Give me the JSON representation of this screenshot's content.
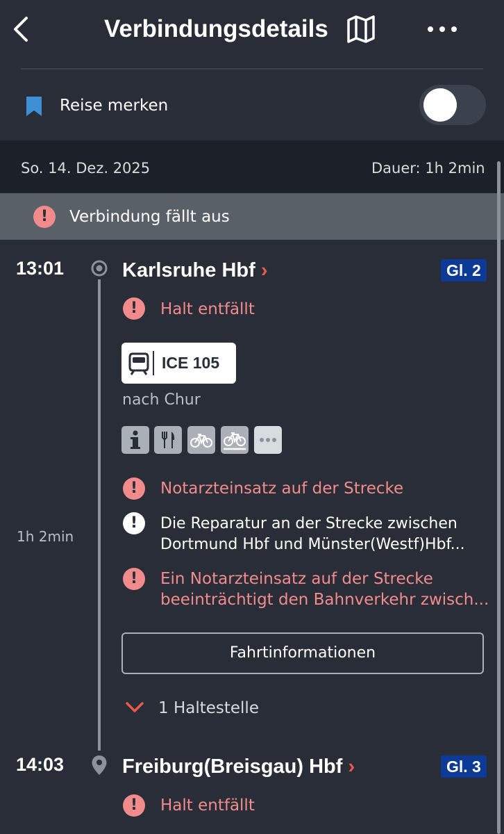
{
  "header": {
    "title": "Verbindungsdetails",
    "back_icon": "chevron-left-icon",
    "map_icon": "map-icon",
    "more_icon": "more-horizontal-icon"
  },
  "save_trip": {
    "label": "Reise merken",
    "icon": "bookmark-icon",
    "enabled": false
  },
  "info_bar": {
    "date": "So. 14. Dez. 2025",
    "duration": "Dauer: 1h 2min"
  },
  "banner": {
    "text": "Verbindung fällt aus"
  },
  "departure": {
    "time": "13:01",
    "station": "Karlsruhe Hbf",
    "chevron": "›",
    "platform": "Gl. 2",
    "stop_status": "Halt entfällt"
  },
  "train": {
    "name": "ICE 105",
    "direction": "nach Chur",
    "amenities": [
      "info-icon",
      "restaurant-icon",
      "bike-icon",
      "bike-reservation-icon",
      "more-icon"
    ]
  },
  "travel_time": "1h 2min",
  "messages": [
    {
      "severity": "error",
      "text": "Notarzteinsatz auf der Strecke"
    },
    {
      "severity": "info",
      "line1": "Die Reparatur an der Strecke zwischen",
      "line2": "Dortmund Hbf und Münster(Westf)Hbf..."
    },
    {
      "severity": "error",
      "line1": "Ein Notarzteinsatz auf der Strecke",
      "line2": "beeinträchtigt den Bahnverkehr zwisch..."
    }
  ],
  "trip_info_button": "Fahrtinformationen",
  "intermediate_stops": "1 Haltestelle",
  "arrival": {
    "time": "14:03",
    "station": "Freiburg(Breisgau) Hbf",
    "chevron": "›",
    "platform": "Gl. 3",
    "stop_status": "Halt entfällt"
  },
  "colors": {
    "background": "#282d37",
    "date_bar": "#1c2129",
    "banner": "#5a6068",
    "error": "#f28c8c",
    "accent_red": "#ec5a4c",
    "platform": "#0c3a96",
    "bookmark": "#3f8fd4"
  }
}
